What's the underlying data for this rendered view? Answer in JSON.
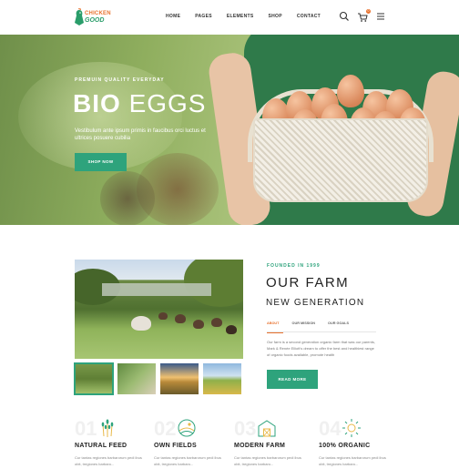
{
  "brand": {
    "name_top": "CHICKEN",
    "name_bottom": "GOOD"
  },
  "nav": {
    "items": [
      "HOME",
      "PAGES",
      "ELEMENTS",
      "SHOP",
      "CONTACT"
    ]
  },
  "header_icons": {
    "search": "search-icon",
    "cart": "cart-icon",
    "cart_count": "0",
    "menu": "menu-icon"
  },
  "hero": {
    "kicker": "PREMUIN QUALITY EVERYDAY",
    "title_bold": "BIO",
    "title_light": "EGGS",
    "subtitle": "Vestibulum ante ipsum primis in faucibus orci luctus et ultrices posuere cubilia",
    "button": "SHOP NOW"
  },
  "farm": {
    "founded": "FOUNDED IN 1999",
    "title": "OUR FARM",
    "subtitle": "NEW GENERATION",
    "tabs": [
      "ABOUT",
      "OUR MISSION",
      "OUR GOALS"
    ],
    "active_tab": "ABOUT",
    "text": "Our farm is a second generation organic farm that was our parents, Mark & Renée Elliott's dream to offer the best and healthiest range of organic foods available, promote health",
    "button": "READ MORE"
  },
  "features": [
    {
      "num": "01",
      "icon": "wheat-icon",
      "title": "NATURAL FEED",
      "text": "Cur tantas regiones barbarorum pedi ibus obit, tregiones barbaro..."
    },
    {
      "num": "02",
      "icon": "field-icon",
      "title": "OWN FIELDS",
      "text": "Cur tantas regiones barbarorum pedi ibus obit, tregiones barbaro..."
    },
    {
      "num": "03",
      "icon": "barn-icon",
      "title": "MODERN FARM",
      "text": "Cur tantas regiones barbarorum pedi ibus obit, tregiones barbaro..."
    },
    {
      "num": "04",
      "icon": "sun-icon",
      "title": "100% ORGANIC",
      "text": "Cur tantas regiones barbarorum pedi ibus obit, tregiones barbaro..."
    }
  ],
  "colors": {
    "accent": "#2ea37c",
    "orange": "#e8722e",
    "dark": "#222222"
  }
}
